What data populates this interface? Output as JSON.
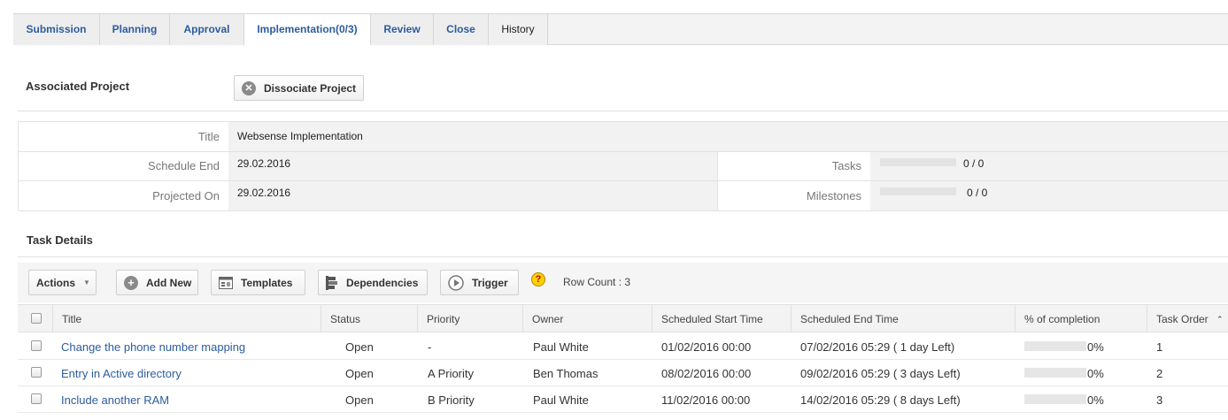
{
  "tabs": [
    {
      "label": "Submission"
    },
    {
      "label": "Planning"
    },
    {
      "label": "Approval"
    },
    {
      "label": "Implementation(0/3)"
    },
    {
      "label": "Review"
    },
    {
      "label": "Close"
    },
    {
      "label": "History"
    }
  ],
  "active_tab": "Implementation(0/3)",
  "associated_project": {
    "label": "Associated Project",
    "dissociate_label": "Dissociate Project",
    "dissociate_icon": "close-icon"
  },
  "project_info": {
    "title_label": "Title",
    "title_value": "Websense Implementation",
    "schedule_end_label": "Schedule End",
    "schedule_end_value": "29.02.2016",
    "projected_on_label": "Projected On",
    "projected_on_value": "29.02.2016",
    "tasks_label": "Tasks",
    "tasks_value": "0 / 0",
    "tasks_progress": 0,
    "milestones_label": "Milestones",
    "milestones_value": "0 / 0",
    "milestones_progress": 0
  },
  "task_details": {
    "title": "Task Details",
    "toolbar": {
      "actions_label": "Actions",
      "add_new_label": "Add New",
      "templates_label": "Templates",
      "dependencies_label": "Dependencies",
      "trigger_label": "Trigger",
      "help_glyph": "?",
      "row_count_text": "Row Count : 3"
    },
    "columns": [
      "Title",
      "Status",
      "Priority",
      "Owner",
      "Scheduled Start Time",
      "Scheduled End Time",
      "% of completion",
      "Task Order"
    ],
    "rows": [
      {
        "title": "Change the phone number mapping",
        "status": "Open",
        "priority": "-",
        "owner": "Paul White",
        "start": "01/02/2016 00:00",
        "end": "07/02/2016 05:29 ( 1 day Left)",
        "completion": "0%",
        "order": "1"
      },
      {
        "title": "Entry in Active directory",
        "status": "Open",
        "priority": "A Priority",
        "owner": "Ben Thomas",
        "start": "08/02/2016 00:00",
        "end": "09/02/2016 05:29 ( 3 days Left)",
        "completion": "0%",
        "order": "2"
      },
      {
        "title": "Include another RAM",
        "status": "Open",
        "priority": "B Priority",
        "owner": "Paul White",
        "start": "11/02/2016 00:00",
        "end": "14/02/2016 05:29 ( 8 days Left)",
        "completion": "0%",
        "order": "3"
      }
    ]
  },
  "colors": {
    "link": "#2d5c9e",
    "tab_bg": "#eeeeee",
    "header_bg": "#f3f3f3",
    "help_icon": "#ffd000"
  }
}
